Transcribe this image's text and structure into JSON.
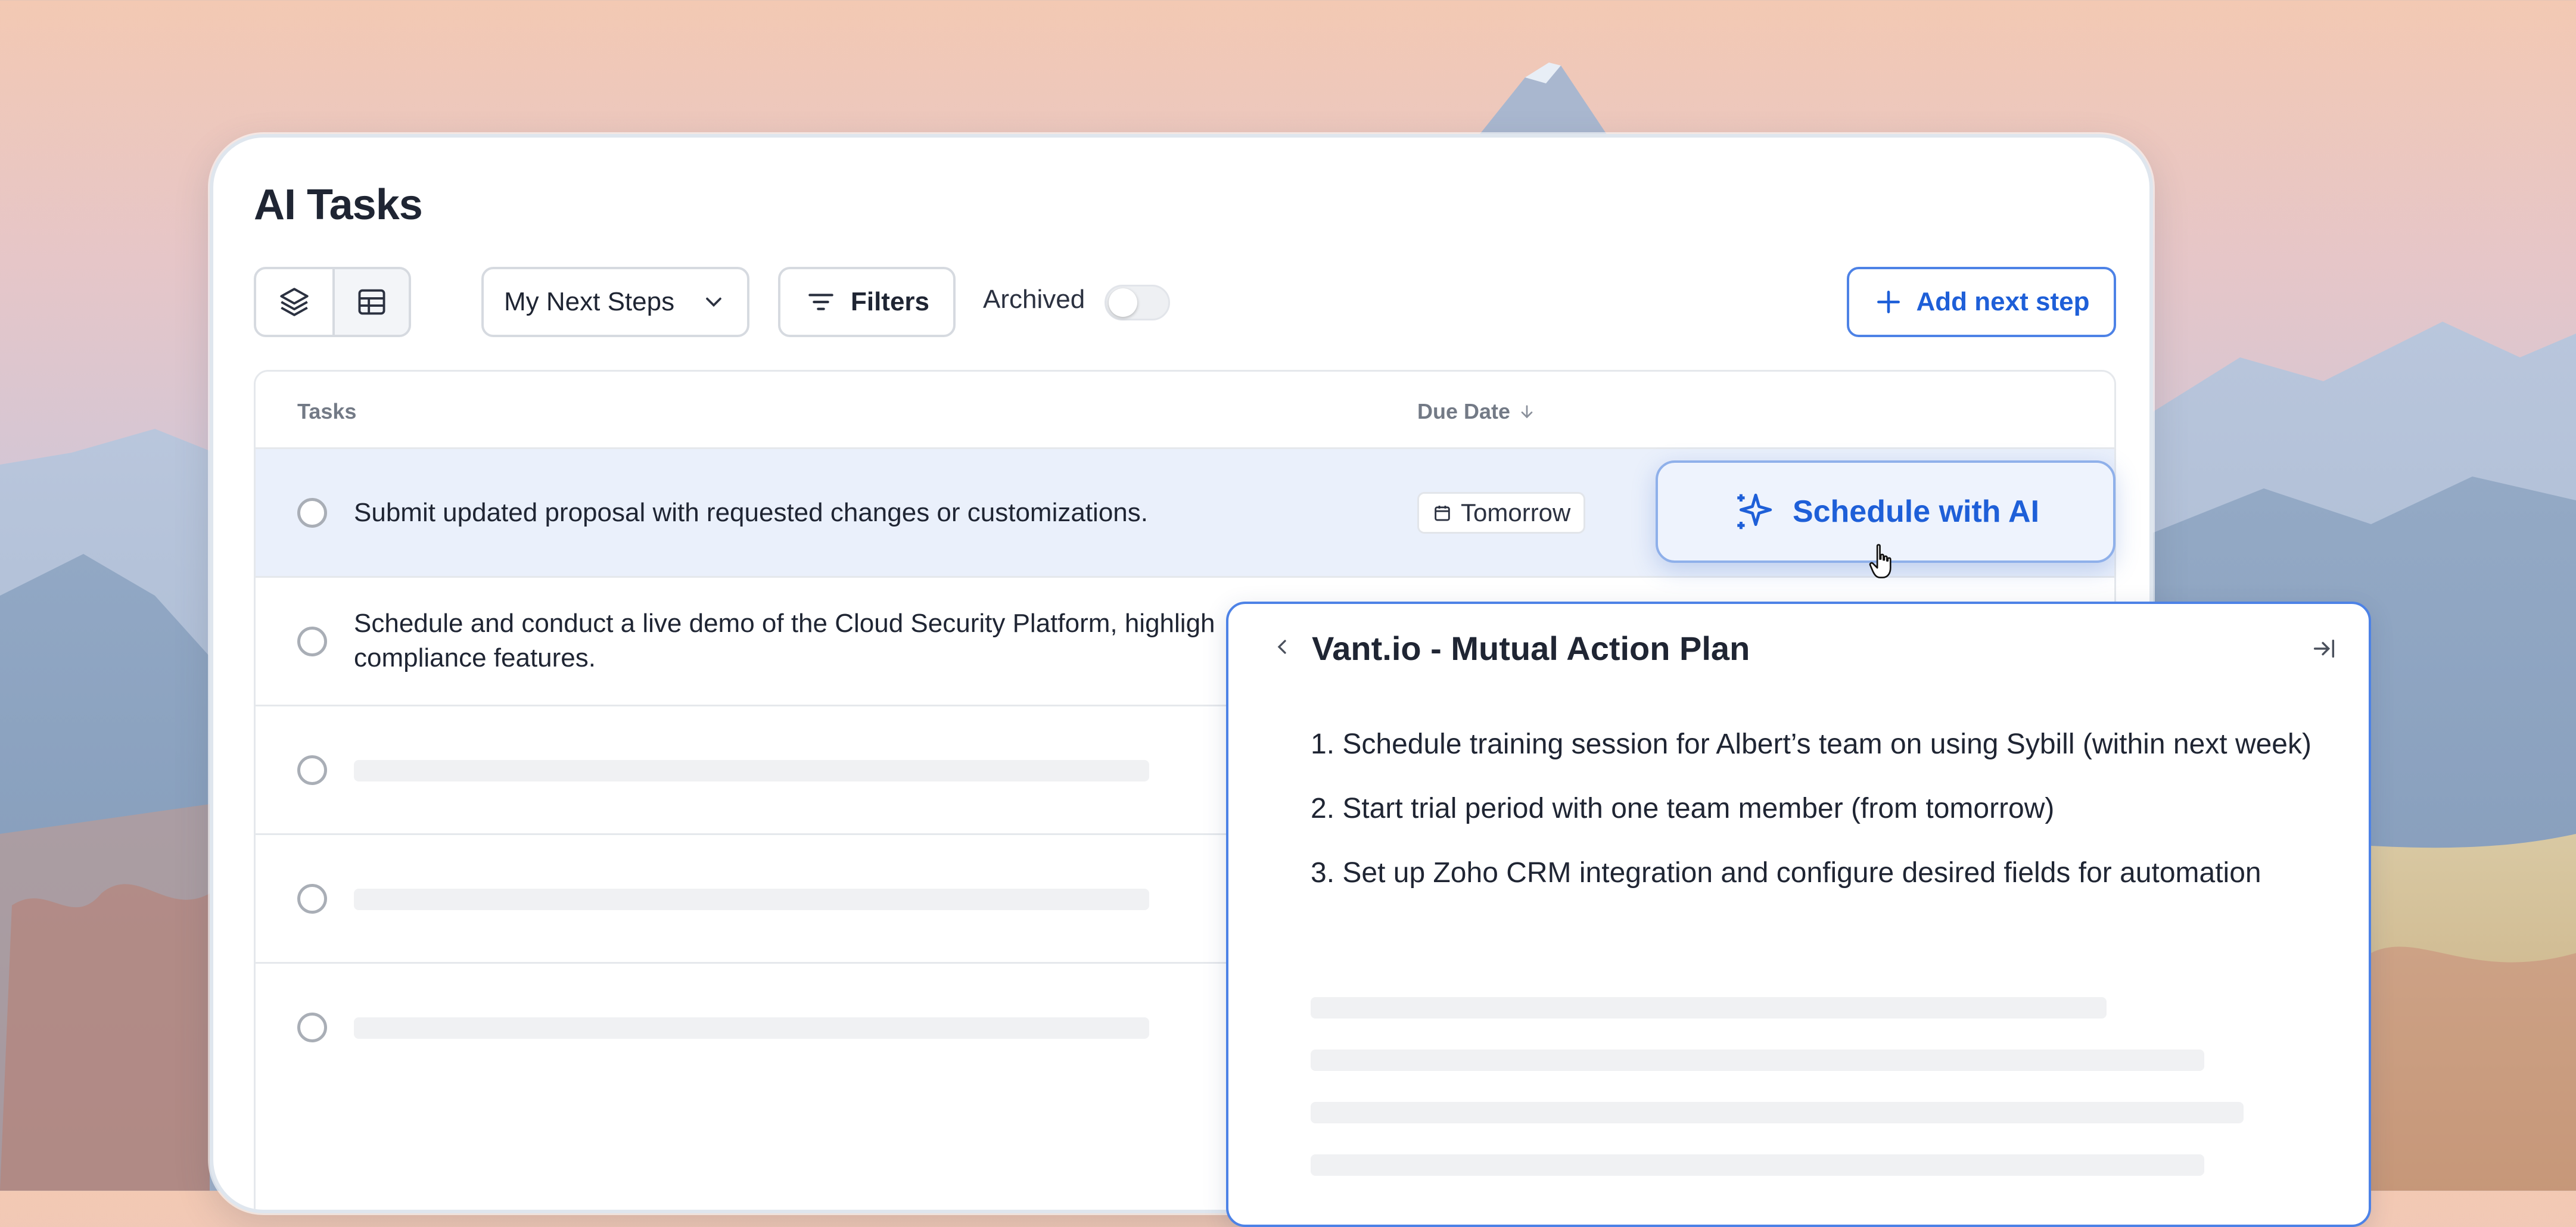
{
  "page": {
    "title": "AI Tasks"
  },
  "toolbar": {
    "view_toggle": [
      {
        "icon": "layers-icon"
      },
      {
        "icon": "table-icon"
      }
    ],
    "view_select": {
      "value": "My Next Steps",
      "icon": "chevron-down-icon"
    },
    "filters_label": "Filters",
    "archived_label": "Archived",
    "archived_on": false,
    "add_label": "Add next step"
  },
  "table": {
    "headers": {
      "tasks": "Tasks",
      "due_date": "Due Date",
      "sort_icon": "arrow-down-icon"
    },
    "rows": [
      {
        "text": "Submit updated proposal with requested changes or customizations.",
        "due": "Tomorrow",
        "highlighted": true
      },
      {
        "text_line1": "Schedule and conduct a live demo of the Cloud Security Platform, highligh",
        "text_line2": "compliance features.",
        "due": ""
      },
      {
        "loading": true
      },
      {
        "loading": true
      },
      {
        "loading": true
      }
    ]
  },
  "schedule_button": {
    "label": "Schedule with AI",
    "icon": "sparkle-icon"
  },
  "panel": {
    "title": "Vant.io - Mutual Action Plan",
    "items": [
      "1. Schedule training session for Albert’s team on using Sybill (within next week)",
      "2. Start trial period with one team member (from tomorrow)",
      "3. Set up Zoho CRM integration and configure desired fields for automation"
    ]
  },
  "colors": {
    "accent": "#1e5fd8",
    "row_highlight": "#eaf0fb",
    "border": "#e5e8ec",
    "skeleton": "#f0f1f3",
    "text": "#1f2533"
  }
}
